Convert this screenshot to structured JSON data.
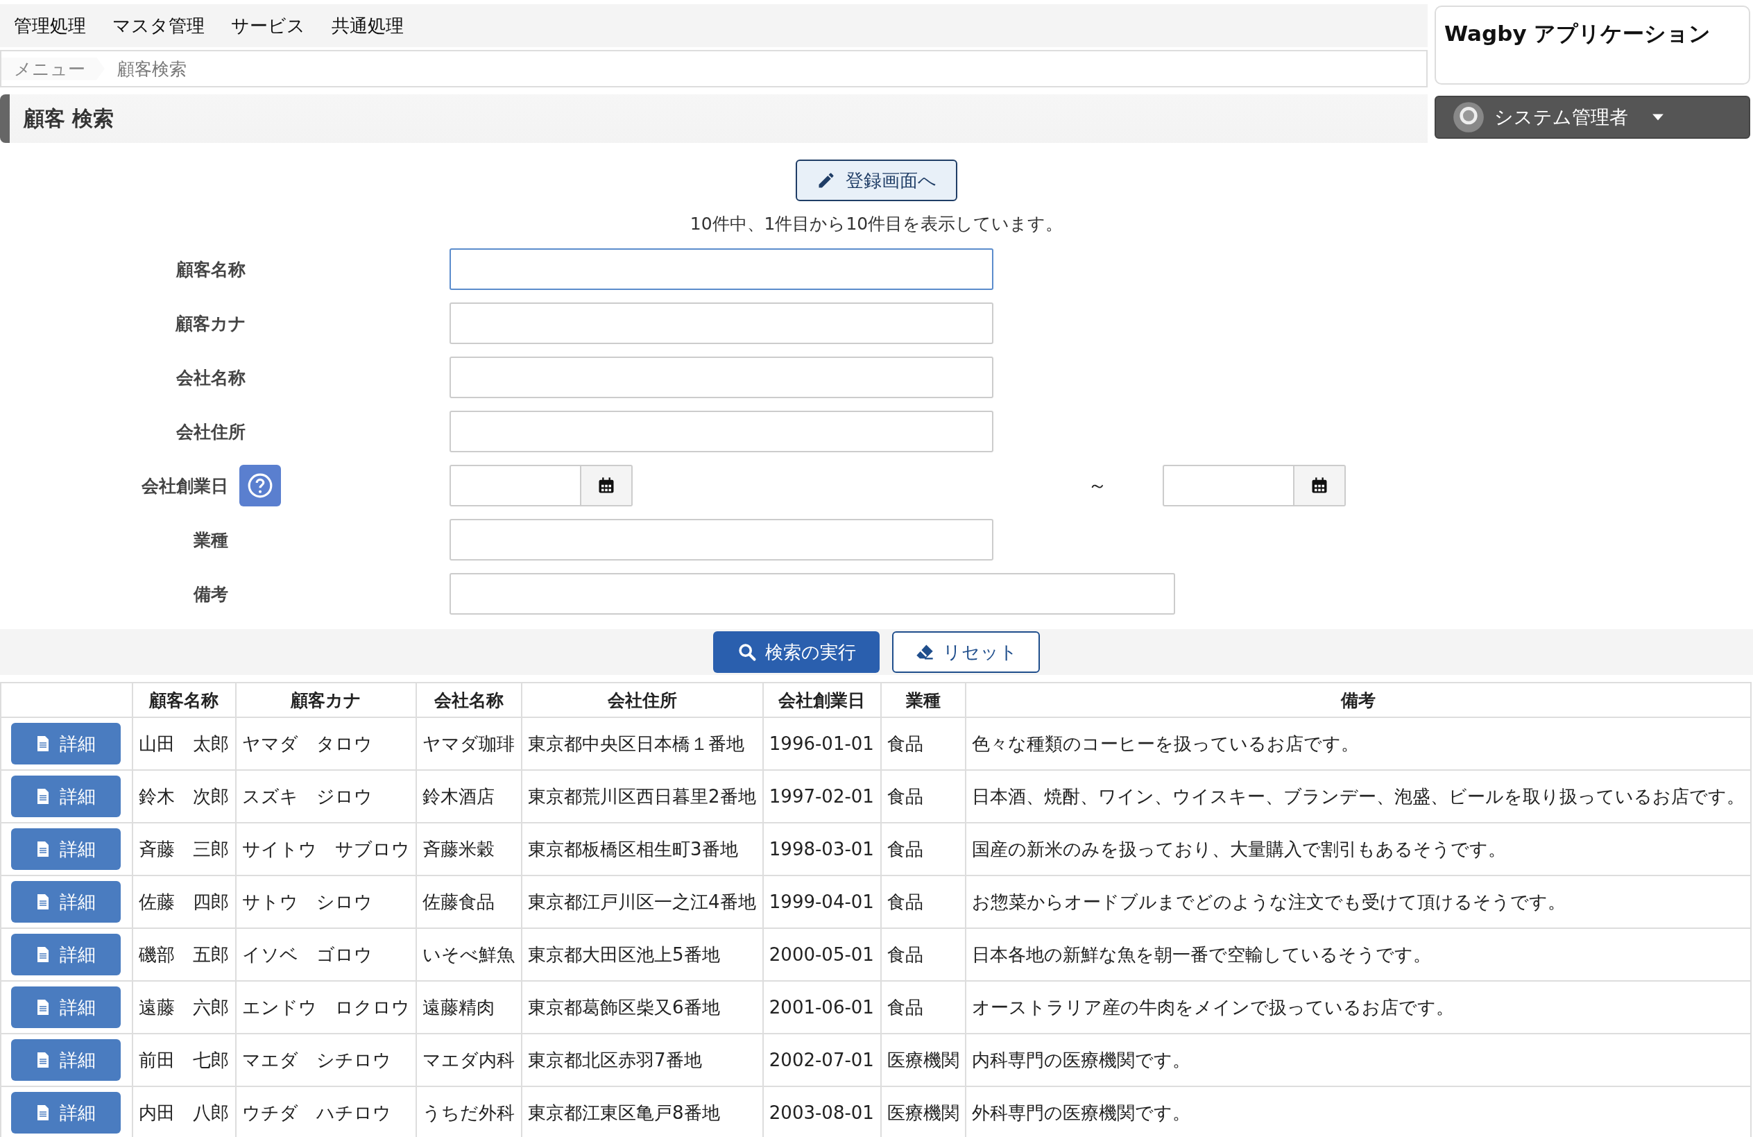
{
  "menu_bar": {
    "items": [
      "管理処理",
      "マスタ管理",
      "サービス",
      "共通処理"
    ]
  },
  "breadcrumb": [
    "メニュー",
    "顧客検索"
  ],
  "app_title": "Wagby アプリケーション",
  "page_title": "顧客 検索",
  "user_menu": {
    "label": "システム管理者"
  },
  "register_button": "登録画面へ",
  "result_summary": "10件中、1件目から10件目を表示しています。",
  "search_form": {
    "fields": [
      {
        "label": "顧客名称",
        "kind": "text",
        "focused": true,
        "help": false
      },
      {
        "label": "顧客カナ",
        "kind": "text",
        "focused": false,
        "help": false
      },
      {
        "label": "会社名称",
        "kind": "text",
        "focused": false,
        "help": false
      },
      {
        "label": "会社住所",
        "kind": "text",
        "focused": false,
        "help": false
      },
      {
        "label": "会社創業日",
        "kind": "date_range",
        "focused": false,
        "help": true
      },
      {
        "label": "業種",
        "kind": "text",
        "focused": false,
        "help": false
      },
      {
        "label": "備考",
        "kind": "long_text",
        "focused": false,
        "help": false
      }
    ],
    "range_separator": "～"
  },
  "search_button": "検索の実行",
  "reset_button": "リセット",
  "table": {
    "columns": [
      "顧客名称",
      "顧客カナ",
      "会社名称",
      "会社住所",
      "会社創業日",
      "業種",
      "備考"
    ],
    "rows": [
      {
        "action": "詳細",
        "cells": [
          "山田　太郎",
          "ヤマダ　タロウ",
          "ヤマダ珈琲",
          "東京都中央区日本橋１番地",
          "1996-01-01",
          "食品",
          "色々な種類のコーヒーを扱っているお店です。"
        ]
      },
      {
        "action": "詳細",
        "cells": [
          "鈴木　次郎",
          "スズキ　ジロウ",
          "鈴木酒店",
          "東京都荒川区西日暮里2番地",
          "1997-02-01",
          "食品",
          "日本酒、焼酎、ワイン、ウイスキー、ブランデー、泡盛、ビールを取り扱っているお店です。"
        ]
      },
      {
        "action": "詳細",
        "cells": [
          "斉藤　三郎",
          "サイトウ　サブロウ",
          "斉藤米穀",
          "東京都板橋区相生町3番地",
          "1998-03-01",
          "食品",
          "国産の新米のみを扱っており、大量購入で割引もあるそうです。"
        ]
      },
      {
        "action": "詳細",
        "cells": [
          "佐藤　四郎",
          "サトウ　シロウ",
          "佐藤食品",
          "東京都江戸川区一之江4番地",
          "1999-04-01",
          "食品",
          "お惣菜からオードブルまでどのような注文でも受けて頂けるそうです。"
        ]
      },
      {
        "action": "詳細",
        "cells": [
          "磯部　五郎",
          "イソベ　ゴロウ",
          "いそべ鮮魚",
          "東京都大田区池上5番地",
          "2000-05-01",
          "食品",
          "日本各地の新鮮な魚を朝一番で空輸しているそうです。"
        ]
      },
      {
        "action": "詳細",
        "cells": [
          "遠藤　六郎",
          "エンドウ　ロクロウ",
          "遠藤精肉",
          "東京都葛飾区柴又6番地",
          "2001-06-01",
          "食品",
          "オーストラリア産の牛肉をメインで扱っているお店です。"
        ]
      },
      {
        "action": "詳細",
        "cells": [
          "前田　七郎",
          "マエダ　シチロウ",
          "マエダ内科",
          "東京都北区赤羽7番地",
          "2002-07-01",
          "医療機関",
          "内科専門の医療機関です。"
        ]
      },
      {
        "action": "詳細",
        "cells": [
          "内田　八郎",
          "ウチダ　ハチロウ",
          "うちだ外科",
          "東京都江東区亀戸8番地",
          "2003-08-01",
          "医療機関",
          "外科専門の医療機関です。"
        ]
      }
    ]
  }
}
